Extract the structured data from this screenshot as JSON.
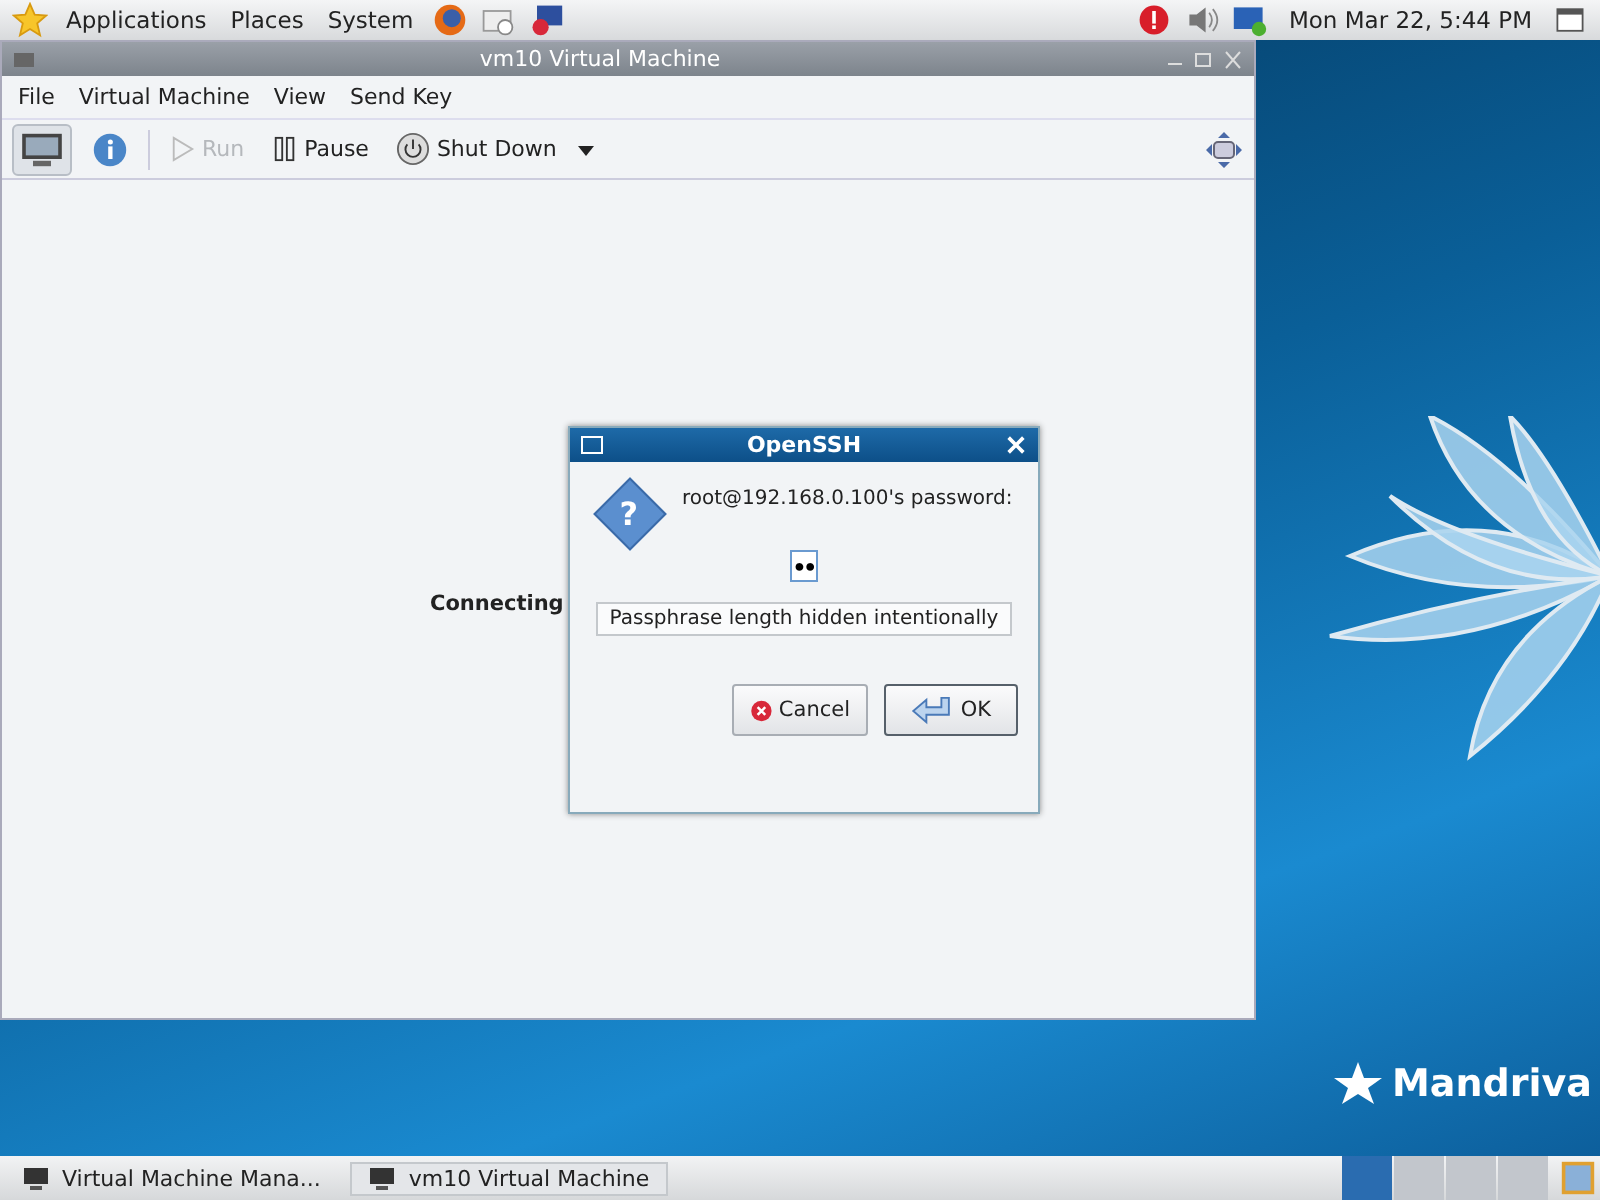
{
  "top_panel": {
    "menus": [
      "Applications",
      "Places",
      "System"
    ],
    "clock": "Mon Mar 22,  5:44 PM"
  },
  "window": {
    "title": "vm10 Virtual Machine",
    "menu": [
      {
        "label": "File"
      },
      {
        "label": "Virtual Machine"
      },
      {
        "label": "View"
      },
      {
        "label": "Send Key"
      }
    ],
    "toolbar": [
      {
        "kind": "console",
        "selected": true
      },
      {
        "kind": "info",
        "selected": false
      },
      {
        "kind": "run",
        "label": "Run",
        "disabled": true
      },
      {
        "kind": "pause",
        "label": "Pause",
        "disabled": false
      },
      {
        "kind": "shutdown",
        "label": "Shut Down",
        "disabled": false
      }
    ],
    "status": "Connecting"
  },
  "dialog": {
    "title": "OpenSSH",
    "icon_glyph": "?",
    "prompt": "root@192.168.0.100's password:",
    "value": "●●",
    "hint": "Passphrase length hidden intentionally",
    "buttons": [
      {
        "kind": "cancel",
        "label": "Cancel"
      },
      {
        "kind": "ok",
        "label": "OK"
      }
    ]
  },
  "desktop": {
    "logo": "Mandriva"
  },
  "taskbar": {
    "tasks": [
      {
        "label": "Virtual Machine Mana...",
        "selected": false
      },
      {
        "label": "vm10 Virtual Machine",
        "selected": true
      }
    ],
    "workspaces": [
      {
        "selected": true
      },
      {
        "selected": false
      },
      {
        "selected": false
      },
      {
        "selected": false
      }
    ]
  }
}
